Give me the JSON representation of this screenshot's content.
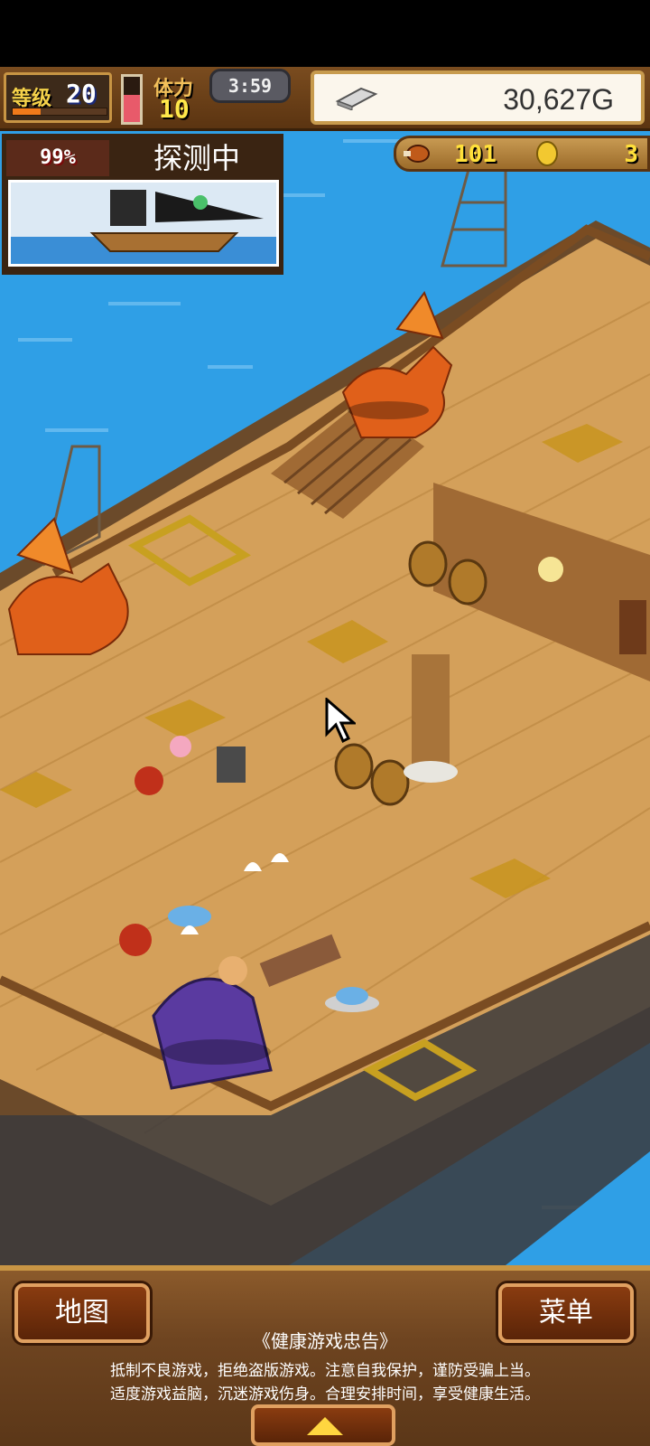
{
  "hud": {
    "level_label": "等级",
    "level_value": "20",
    "level_exp_fraction": 0.3,
    "stamina_label": "体力",
    "stamina_value": "10",
    "stamina_fraction": 0.6,
    "timer": "3:59",
    "gold": "30,627G"
  },
  "explore": {
    "percent": "99%",
    "status": "探测中"
  },
  "resources": {
    "food": "101",
    "coins": "3"
  },
  "bottom": {
    "map_button": "地图",
    "menu_button": "菜单",
    "notice_title": "《健康游戏忠告》",
    "notice_line1": "抵制不良游戏，拒绝盗版游戏。注意自我保护，谨防受骗上当。",
    "notice_line2": "适度游戏益脑，沉迷游戏伤身。合理安排时间，享受健康生活。"
  },
  "colors": {
    "sea": "#2f9fe6",
    "deck": "#d4a05a",
    "accent_gold": "#c89544"
  }
}
